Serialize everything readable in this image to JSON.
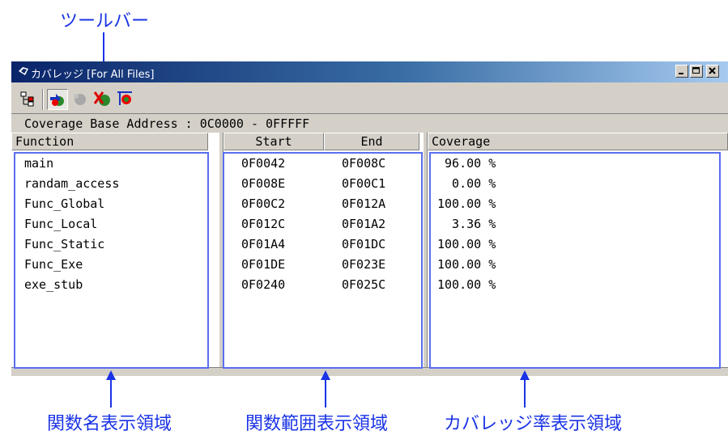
{
  "annotations": {
    "toolbar": "ツールバー",
    "function_area": "関数名表示領域",
    "range_area": "関数範囲表示領域",
    "coverage_area": "カバレッジ率表示領域",
    "color": "#1a33e6"
  },
  "window": {
    "title": "カバレッジ [For All Files]",
    "controls": [
      "minimize",
      "maximize",
      "close"
    ]
  },
  "toolbar": {
    "buttons": [
      {
        "icon": "tree-view-icon"
      },
      {
        "icon": "refresh-coverage-icon",
        "pressed": true
      },
      {
        "icon": "disabled-gear-icon",
        "disabled": true
      },
      {
        "icon": "clear-coverage-icon"
      },
      {
        "icon": "range-select-icon"
      }
    ]
  },
  "info": {
    "base_address": "Coverage Base Address : 0C0000 - 0FFFFF"
  },
  "columns": {
    "function": "Function",
    "start": "Start",
    "end": "End",
    "coverage": "Coverage"
  },
  "rows": [
    {
      "function": "main",
      "start": "0F0042",
      "end": "0F008C",
      "coverage": " 96.00 %"
    },
    {
      "function": "randam_access",
      "start": "0F008E",
      "end": "0F00C1",
      "coverage": "  0.00 %"
    },
    {
      "function": "Func_Global",
      "start": "0F00C2",
      "end": "0F012A",
      "coverage": "100.00 %"
    },
    {
      "function": "Func_Local",
      "start": "0F012C",
      "end": "0F01A2",
      "coverage": "  3.36 %"
    },
    {
      "function": "Func_Static",
      "start": "0F01A4",
      "end": "0F01DC",
      "coverage": "100.00 %"
    },
    {
      "function": "Func_Exe",
      "start": "0F01DE",
      "end": "0F023E",
      "coverage": "100.00 %"
    },
    {
      "function": "exe_stub",
      "start": "0F0240",
      "end": "0F025C",
      "coverage": "100.00 %"
    }
  ]
}
